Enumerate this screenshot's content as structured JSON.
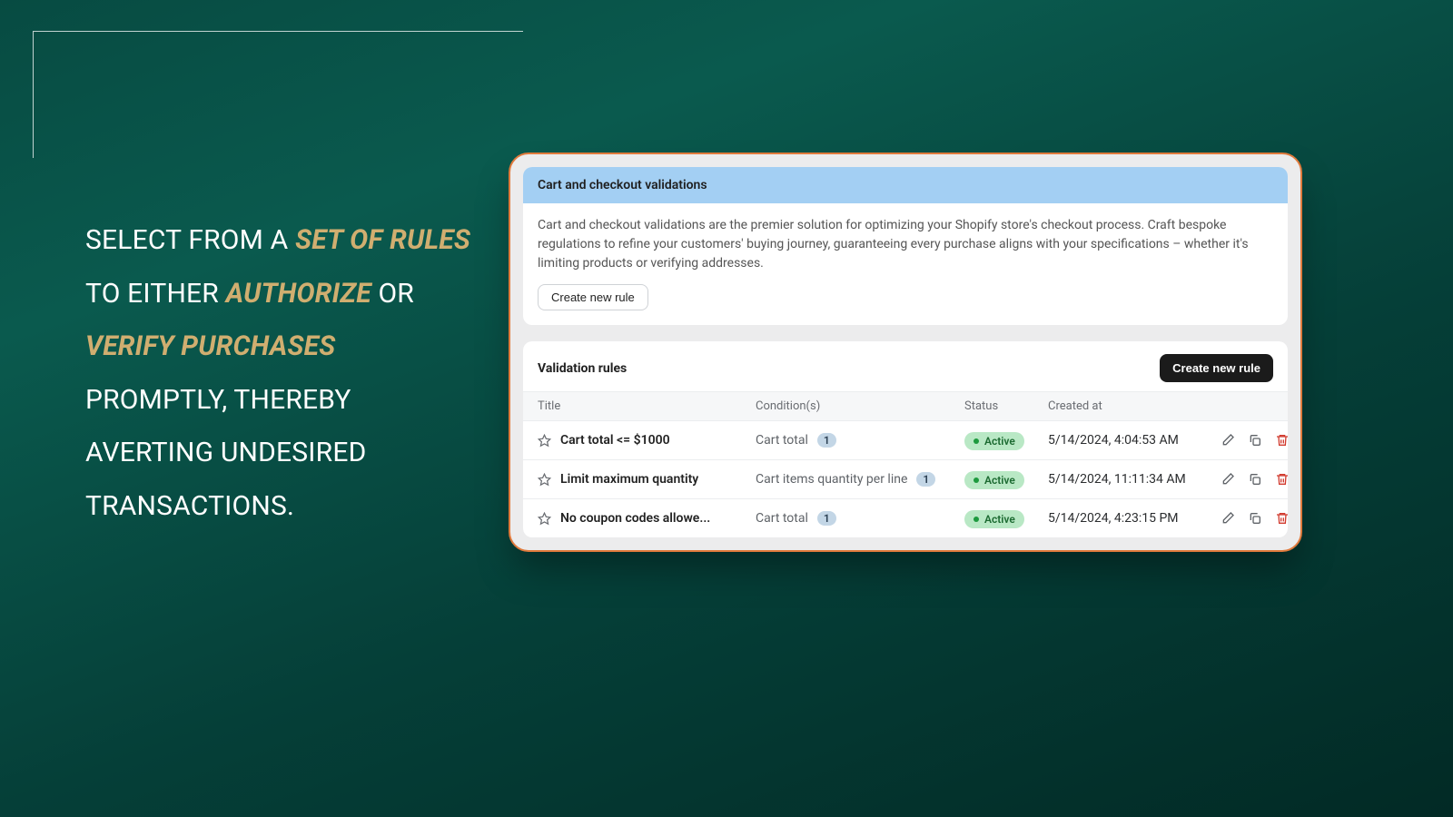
{
  "marketing": {
    "prefix": "SELECT FROM A ",
    "em1": "SET OF RULES",
    "mid1": " TO EITHER ",
    "em2": "AUTHORIZE",
    "mid2": " OR ",
    "em3": "VERIFY PURCHASES",
    "suffix": " PROMPTLY, THEREBY AVERTING UNDESIRED TRANSACTIONS."
  },
  "panel": {
    "header": {
      "title": "Cart and checkout validations",
      "description": "Cart and checkout validations are the premier solution for optimizing your Shopify store's checkout process. Craft bespoke regulations to refine your customers' buying journey, guaranteeing every purchase aligns with your specifications – whether it's limiting products or verifying addresses.",
      "create_button": "Create new rule"
    },
    "rules": {
      "title": "Validation rules",
      "create_button": "Create new rule",
      "columns": {
        "title": "Title",
        "conditions": "Condition(s)",
        "status": "Status",
        "created_at": "Created at"
      },
      "items": [
        {
          "title": "Cart total <= $1000",
          "condition": "Cart total",
          "count": "1",
          "status": "Active",
          "created_at": "5/14/2024, 4:04:53 AM"
        },
        {
          "title": "Limit maximum quantity",
          "condition": "Cart items quantity per line",
          "count": "1",
          "status": "Active",
          "created_at": "5/14/2024, 11:11:34 AM"
        },
        {
          "title": "No coupon codes allowe...",
          "condition": "Cart total",
          "count": "1",
          "status": "Active",
          "created_at": "5/14/2024, 4:23:15 PM"
        }
      ]
    }
  }
}
